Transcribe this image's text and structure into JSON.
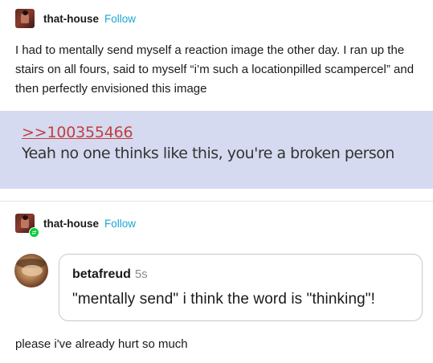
{
  "post": {
    "username": "that-house",
    "follow_label": "Follow",
    "body": "I had to mentally send myself a reaction image the other day. I ran up the stairs on all fours, said to myself “i’m such a locationpilled scampercel” and then perfectly envisioned this image",
    "image": {
      "reply_link": ">>100355466",
      "text": "Yeah no one thinks like this, you're a broken person"
    }
  },
  "reblog": {
    "username": "that-house",
    "follow_label": "Follow",
    "message": {
      "sender": "betafreud",
      "time": "5s",
      "text": "\"mentally send\" i think the word is \"thinking\"!"
    },
    "body": "please i've already hurt so much"
  },
  "colors": {
    "follow": "#1aa7d6",
    "image_bg": "#d6daf0",
    "reply_link": "#c04040",
    "reblog_badge": "#01cf35"
  }
}
